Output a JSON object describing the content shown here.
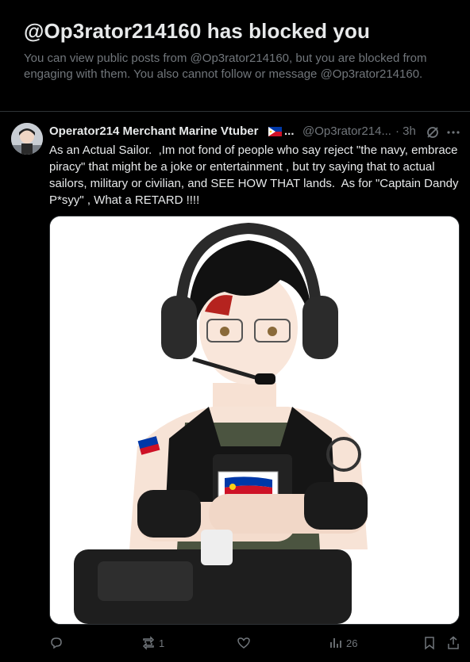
{
  "blocked": {
    "title": "@Op3rator214160 has blocked you",
    "message": "You can view public posts from @Op3rator214160, but you are blocked from engaging with them. You also cannot follow or message @Op3rator214160."
  },
  "post": {
    "display_name": "Operator214 Merchant Marine Vtuber",
    "name_ellipsis": "...",
    "handle": "@Op3rator214...",
    "time": "· 3h",
    "text": "As an Actual Sailor.  ,Im not fond of people who say reject \"the navy, embrace piracy\" that might be a joke or entertainment , but try saying that to actual sailors, military or civilian, and SEE HOW THAT lands.  As for \"Captain Dandy P*syy\" , What a RETARD !!!!",
    "media_alt": "Vtuber character with headset, glasses and tactical vest with Philippine flag patch"
  },
  "actions": {
    "reply_count": "",
    "repost_count": "1",
    "like_count": "",
    "views_count": "26"
  },
  "icons": {
    "reply": "reply-icon",
    "repost": "repost-icon",
    "like": "like-icon",
    "views": "views-icon",
    "bookmark": "bookmark-icon",
    "share": "share-icon",
    "grok": "grok-icon",
    "more": "more-icon"
  },
  "colors": {
    "background": "#000000",
    "text": "#e7e9ea",
    "muted": "#71767b",
    "divider": "#2f3336"
  }
}
